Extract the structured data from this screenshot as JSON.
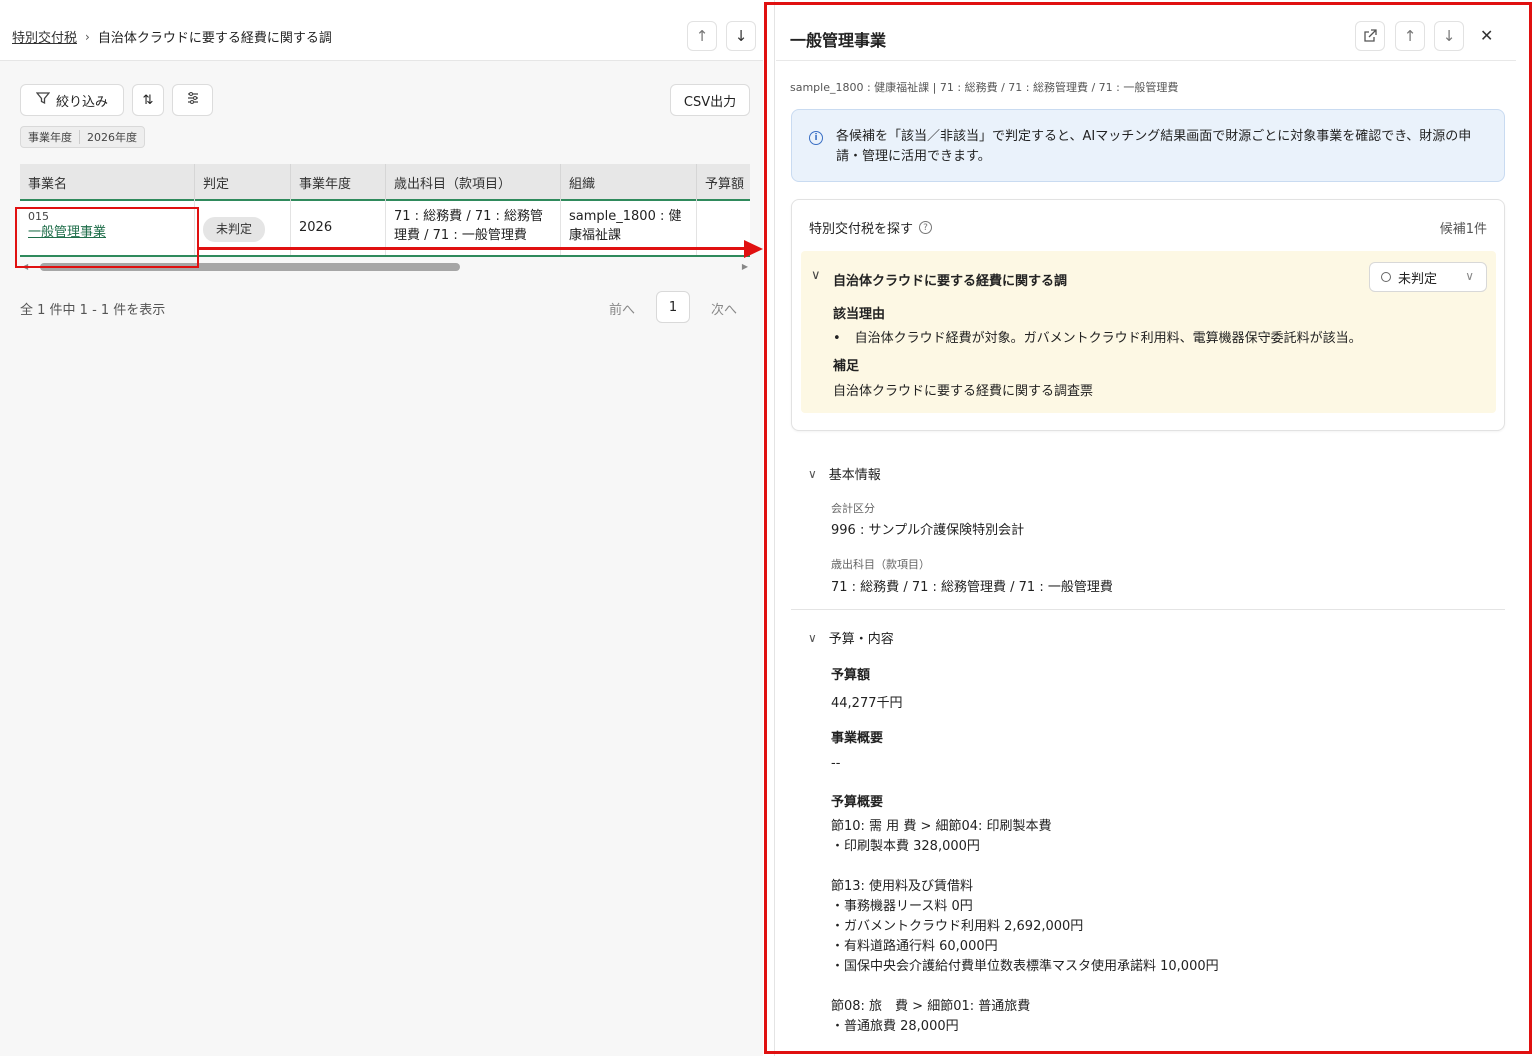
{
  "breadcrumb": {
    "root": "特別交付税",
    "current": "自治体クラウドに要する経費に関する調"
  },
  "toolbar": {
    "filter_label": "絞り込み",
    "csv_label": "CSV出力"
  },
  "filter_chip": {
    "key": "事業年度",
    "value": "2026年度"
  },
  "table": {
    "columns": [
      "事業名",
      "判定",
      "事業年度",
      "歳出科目（款項目）",
      "組織",
      "予算額"
    ],
    "row": {
      "code": "015",
      "name": "一般管理事業",
      "status": "未判定",
      "year": "2026",
      "account_line1": "71 : 総務費 / 71 : 総務管",
      "account_line2": "理費 / 71 : 一般管理費",
      "org_line1": "sample_1800 : 健",
      "org_line2": "康福祉課"
    }
  },
  "pager": {
    "summary": "全 1 件中 1 - 1 件を表示",
    "prev": "前へ",
    "page": "1",
    "next": "次へ"
  },
  "detail": {
    "title": "一般管理事業",
    "subtitle": "sample_1800 : 健康福祉課 | 71 : 総務費 / 71 : 総務管理費 / 71 : 一般管理費",
    "info_icon_text": "i",
    "info_text": "各候補を「該当／非該当」で判定すると、AIマッチング結果画面で財源ごとに対象事業を確認でき、財源の申請・管理に活用できます。",
    "search_card": {
      "heading": "特別交付税を探す",
      "help_icon_text": "?",
      "count": "候補1件",
      "candidate_title": "自治体クラウドに要する経費に関する調",
      "status": "未判定",
      "reason_label": "該当理由",
      "reason": "自治体クラウド経費が対象。ガバメントクラウド利用料、電算機器保守委託料が該当。",
      "note_label": "補足",
      "note": "自治体クラウドに要する経費に関する調査票"
    },
    "basic": {
      "heading": "基本情報",
      "account_label": "会計区分",
      "account_value": "996 : サンプル介護保険特別会計",
      "expense_label": "歳出科目（款項目）",
      "expense_value": "71 : 総務費 / 71 : 総務管理費 / 71 : 一般管理費"
    },
    "budget": {
      "heading": "予算・内容",
      "amount_label": "予算額",
      "amount": "44,277千円",
      "overview_label": "事業概要",
      "overview": "--",
      "summary_label": "予算概要",
      "lines": [
        "節10: 需 用 費 > 細節04: 印刷製本費",
        "・印刷製本費 328,000円",
        "",
        "節13: 使用料及び賃借料",
        "・事務機器リース料 0円",
        "・ガバメントクラウド利用料 2,692,000円",
        "・有料道路通行料 60,000円",
        "・国保中央会介護給付費単位数表標準マスタ使用承諾料 10,000円",
        "",
        "節08: 旅　費 > 細節01: 普通旅費",
        "・普通旅費 28,000円"
      ]
    }
  },
  "colors": {
    "highlight": "#e01010",
    "accent_green": "#2f8a5c",
    "info_bg": "#eaf2fb",
    "candidate_bg": "#fdf8e4"
  }
}
